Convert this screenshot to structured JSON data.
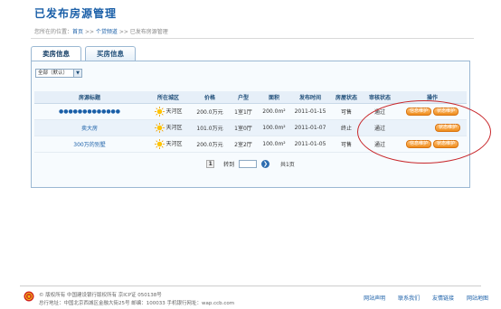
{
  "page": {
    "title": "已发布房源管理"
  },
  "breadcrumb": {
    "prefix": "您所在的位置：",
    "home": "首页",
    "sep1": " >> ",
    "channel": "个贷频道",
    "sep2": " >> ",
    "current": "已发布房源管理"
  },
  "tabs": [
    {
      "label": "卖房信息",
      "active": true
    },
    {
      "label": "买房信息",
      "active": false
    }
  ],
  "filter": {
    "selected": "全部（默认）",
    "chevron": "▼"
  },
  "table": {
    "headers": [
      "房源标题",
      "所在城区",
      "价格",
      "户型",
      "面积",
      "发布时间",
      "房屋状态",
      "审核状态",
      "操作"
    ],
    "rows": [
      {
        "title": "●●●●●●●●●●●●●",
        "icon": "sun-icon",
        "district": "天河区",
        "price": "200.0万元",
        "layout": "1室1厅",
        "area": "200.0m²",
        "date": "2011-01-15",
        "house_status": "可售",
        "audit_status": "通过",
        "action1": "信息维护",
        "action2": "状态维护"
      },
      {
        "title": "卖大房",
        "icon": "sun-icon",
        "district": "天河区",
        "price": "101.0万元",
        "layout": "1室0厅",
        "area": "100.0m²",
        "date": "2011-01-07",
        "house_status": "终止",
        "audit_status": "通过",
        "action1": "",
        "action2": "状态维护"
      },
      {
        "title": "300万的别墅",
        "icon": "sun-icon",
        "district": "天河区",
        "price": "200.0万元",
        "layout": "2室2厅",
        "area": "100.0m²",
        "date": "2011-01-05",
        "house_status": "可售",
        "audit_status": "通过",
        "action1": "信息维护",
        "action2": "状态维护"
      }
    ]
  },
  "pager": {
    "current_page": "1",
    "jump_label": "转到",
    "go_symbol": "❯",
    "total": "共1页"
  },
  "footer": {
    "line1": "© 版权所有 中国建设银行版权所有 京ICP证 050138号",
    "line2": "总行地址：中国北京西城区金融大街25号    邮编：100033    手机银行网址：wap.ccb.com",
    "links": [
      "网站声明",
      "联系我们",
      "友情链接",
      "网站地图"
    ]
  },
  "colors": {
    "brand_blue": "#1a5fa8",
    "button_orange": "#ee8c1b",
    "annotation_red": "#c8272b"
  }
}
